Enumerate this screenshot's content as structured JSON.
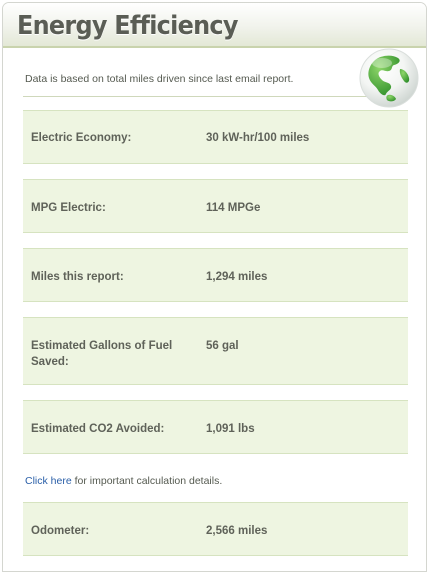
{
  "panel": {
    "title": "Energy Efficiency",
    "intro": "Data is based on total miles driven since last email report."
  },
  "globe": {
    "icon": "globe-icon"
  },
  "rows": [
    {
      "label": "Electric Economy:",
      "value": "30 kW-hr/100 miles"
    },
    {
      "label": "MPG Electric:",
      "value": "114 MPGe"
    },
    {
      "label": "Miles this report:",
      "value": "1,294 miles"
    },
    {
      "label": "Estimated Gallons of Fuel Saved:",
      "value": "56 gal"
    },
    {
      "label": "Estimated CO2 Avoided:",
      "value": "1,091 lbs"
    }
  ],
  "details": {
    "link_text": "Click here",
    "rest_text": " for important calculation details."
  },
  "odometer": {
    "label": "Odometer:",
    "value": "2,566 miles"
  },
  "colors": {
    "row_background": "#eef5e1",
    "link": "#2a5fa8",
    "title": "#5a5d55"
  }
}
